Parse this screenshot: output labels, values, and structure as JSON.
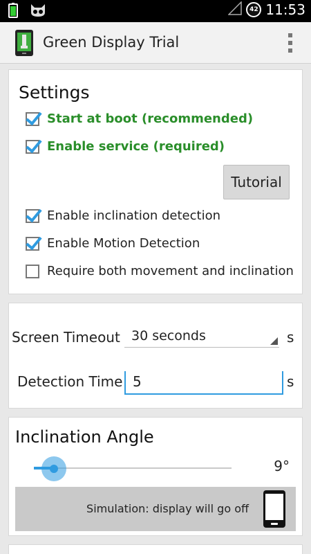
{
  "status_bar": {
    "time": "11:53",
    "battery_level": "42",
    "icons": [
      "battery-icon",
      "cyanogen-mascot-icon",
      "signal-icon"
    ]
  },
  "action_bar": {
    "title": "Green Display Trial",
    "icons": [
      "app-icon",
      "overflow-menu-icon"
    ]
  },
  "settings": {
    "title": "Settings",
    "options": [
      {
        "label": "Start at boot (recommended)",
        "checked": true,
        "emphasis": true
      },
      {
        "label": "Enable service (required)",
        "checked": true,
        "emphasis": true
      },
      {
        "label": "Enable inclination detection",
        "checked": true,
        "emphasis": false
      },
      {
        "label": "Enable Motion Detection",
        "checked": true,
        "emphasis": false
      },
      {
        "label": "Require both movement and inclination",
        "checked": false,
        "emphasis": false
      }
    ],
    "tutorial_button": "Tutorial"
  },
  "timing": {
    "screen_timeout_label": "Screen Timeout",
    "screen_timeout_value": "30 seconds",
    "screen_timeout_unit": "s",
    "detection_time_label": "Detection Time",
    "detection_time_value": "5",
    "detection_time_unit": "s"
  },
  "inclination": {
    "title": "Inclination Angle",
    "value_text": "9°",
    "simulation_text": "Simulation: display will go off"
  },
  "colors": {
    "accent": "#2f9be0",
    "emphasis_green": "#2a8e2a"
  }
}
